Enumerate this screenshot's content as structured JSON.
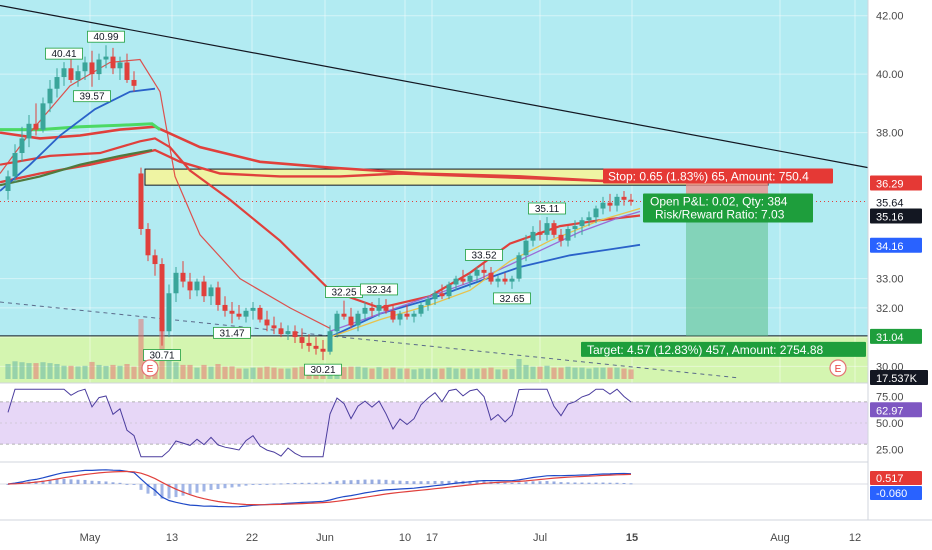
{
  "colors": {
    "bg": "#ffffff",
    "upper_zone": "#b2ebf2",
    "lower_zone": "#d4f5b0",
    "rsi_band": "#e1cdf5",
    "candle_up": "#3aa59a",
    "candle_down": "#e0403c",
    "ma_red": "#e0403c",
    "ma_green": "#4cd964",
    "ma_dark": "#4f7a3d",
    "ma_blue": "#2a62c9",
    "ma_purple": "#9b6bd6",
    "ma_yellow": "#e8c24b",
    "stop_zone": "#f28b86",
    "target_zone": "#5cc08a",
    "rect_fill": "#f5f59a",
    "label_red": "#e53935",
    "label_green": "#1e9e3c",
    "label_dark": "#131722",
    "rsi_line": "#4b3d9e",
    "macd_line": "#1e49c7",
    "signal_line": "#e0403c"
  },
  "price_axis": {
    "ticks": [
      "42.00",
      "40.00",
      "38.00",
      "33.00",
      "32.00",
      "31.00",
      "30.00"
    ],
    "tick_values": [
      42,
      40,
      38,
      33,
      32,
      31,
      30
    ],
    "badges": [
      {
        "text": "36.29",
        "value": 36.29,
        "kind": "red"
      },
      {
        "text": "35.64",
        "value": 35.64,
        "kind": "plain"
      },
      {
        "text": "35.16",
        "value": 35.16,
        "kind": "dark"
      },
      {
        "text": "34.16",
        "value": 34.16,
        "kind": "blue"
      },
      {
        "text": "31.04",
        "value": 31.04,
        "kind": "green"
      },
      {
        "text": "17.537K",
        "value": 0,
        "kind": "dark_volume"
      }
    ]
  },
  "rsi_axis": {
    "ticks": [
      "75.00",
      "50.00",
      "25.00"
    ],
    "tick_values": [
      75,
      50,
      25
    ],
    "badge": "62.97",
    "badge_value": 62.97
  },
  "macd_axis": {
    "badges": [
      "0.517",
      "-0.060"
    ]
  },
  "time_axis": {
    "labels": [
      "May",
      "13",
      "22",
      "Jun",
      "10",
      "17",
      "Jul",
      "15",
      "Aug",
      "12"
    ],
    "highlight": "15"
  },
  "price_labels": [
    {
      "text": "40.41",
      "value": 40.41,
      "idx": 8,
      "pos": "above"
    },
    {
      "text": "40.99",
      "value": 40.99,
      "idx": 14,
      "pos": "above"
    },
    {
      "text": "39.57",
      "value": 39.57,
      "idx": 12,
      "pos": "below"
    },
    {
      "text": "30.71",
      "value": 30.71,
      "idx": 22,
      "pos": "below"
    },
    {
      "text": "31.47",
      "value": 31.47,
      "idx": 32,
      "pos": "below"
    },
    {
      "text": "32.25",
      "value": 32.25,
      "idx": 48,
      "pos": "above"
    },
    {
      "text": "32.34",
      "value": 32.34,
      "idx": 53,
      "pos": "above"
    },
    {
      "text": "30.21",
      "value": 30.21,
      "idx": 45,
      "pos": "below"
    },
    {
      "text": "33.52",
      "value": 33.52,
      "idx": 68,
      "pos": "above"
    },
    {
      "text": "32.65",
      "value": 32.65,
      "idx": 72,
      "pos": "below"
    },
    {
      "text": "35.11",
      "value": 35.11,
      "idx": 77,
      "pos": "above"
    }
  ],
  "position_tool": {
    "stop_label": "Stop: 0.65 (1.83%) 65, Amount: 750.4",
    "pnl_label": "Open P&L: 0.02, Qty: 384",
    "rr_label": "Risk/Reward Ratio: 7.03",
    "target_label": "Target: 4.57 (12.83%) 457, Amount: 2754.88",
    "entry": 35.64,
    "stop": 36.29,
    "target": 31.04
  },
  "events": [
    "E",
    "E"
  ],
  "chart_data": {
    "type": "candlestick",
    "symbol_timeframe": "daily",
    "ohlc": [
      [
        36.0,
        36.7,
        35.7,
        36.5
      ],
      [
        36.5,
        37.6,
        36.3,
        37.3
      ],
      [
        37.3,
        38.2,
        37.0,
        37.8
      ],
      [
        37.8,
        38.6,
        37.5,
        38.3
      ],
      [
        38.3,
        39.0,
        37.9,
        38.1
      ],
      [
        38.1,
        39.2,
        38.0,
        39.0
      ],
      [
        39.0,
        39.8,
        38.7,
        39.5
      ],
      [
        39.5,
        40.2,
        39.2,
        39.9
      ],
      [
        39.9,
        40.41,
        39.6,
        40.2
      ],
      [
        40.2,
        40.5,
        39.7,
        39.8
      ],
      [
        39.8,
        40.3,
        39.57,
        40.1
      ],
      [
        40.1,
        40.6,
        39.8,
        40.4
      ],
      [
        40.4,
        40.8,
        39.57,
        40.0
      ],
      [
        40.0,
        40.7,
        39.8,
        40.5
      ],
      [
        40.5,
        40.99,
        40.2,
        40.6
      ],
      [
        40.6,
        40.9,
        40.0,
        40.2
      ],
      [
        40.2,
        40.6,
        39.8,
        40.4
      ],
      [
        40.4,
        40.7,
        39.7,
        39.8
      ],
      [
        39.8,
        40.1,
        39.4,
        39.6
      ],
      [
        36.6,
        36.8,
        34.5,
        34.7
      ],
      [
        34.7,
        34.9,
        33.6,
        33.8
      ],
      [
        33.8,
        34.0,
        33.1,
        33.5
      ],
      [
        33.5,
        33.7,
        30.71,
        31.2
      ],
      [
        31.2,
        32.8,
        31.0,
        32.5
      ],
      [
        32.5,
        33.4,
        32.2,
        33.2
      ],
      [
        33.2,
        33.6,
        32.7,
        32.9
      ],
      [
        32.9,
        33.2,
        32.3,
        32.6
      ],
      [
        32.6,
        33.0,
        32.4,
        32.9
      ],
      [
        32.9,
        33.1,
        32.2,
        32.4
      ],
      [
        32.4,
        32.8,
        32.1,
        32.7
      ],
      [
        32.7,
        32.9,
        31.9,
        32.1
      ],
      [
        32.1,
        32.4,
        31.7,
        31.9
      ],
      [
        31.9,
        32.2,
        31.47,
        31.8
      ],
      [
        31.8,
        32.1,
        31.6,
        31.7
      ],
      [
        31.7,
        32.0,
        31.5,
        31.9
      ],
      [
        31.9,
        32.2,
        31.6,
        32.0
      ],
      [
        32.0,
        32.1,
        31.5,
        31.6
      ],
      [
        31.6,
        31.9,
        31.2,
        31.4
      ],
      [
        31.4,
        31.7,
        31.1,
        31.3
      ],
      [
        31.3,
        31.5,
        31.0,
        31.1
      ],
      [
        31.1,
        31.4,
        30.9,
        31.2
      ],
      [
        31.2,
        31.4,
        30.8,
        31.0
      ],
      [
        31.0,
        31.3,
        30.6,
        30.8
      ],
      [
        30.8,
        31.1,
        30.5,
        30.7
      ],
      [
        30.7,
        31.0,
        30.4,
        30.6
      ],
      [
        30.6,
        30.9,
        30.21,
        30.5
      ],
      [
        30.5,
        31.4,
        30.4,
        31.2
      ],
      [
        31.2,
        31.9,
        31.0,
        31.8
      ],
      [
        31.8,
        32.25,
        31.6,
        31.7
      ],
      [
        31.7,
        32.0,
        31.3,
        31.4
      ],
      [
        31.4,
        31.9,
        31.2,
        31.8
      ],
      [
        31.8,
        32.2,
        31.6,
        32.0
      ],
      [
        32.0,
        32.2,
        31.7,
        31.9
      ],
      [
        31.9,
        32.34,
        31.7,
        32.1
      ],
      [
        32.1,
        32.3,
        31.8,
        31.9
      ],
      [
        31.9,
        32.1,
        31.5,
        31.6
      ],
      [
        31.6,
        31.9,
        31.4,
        31.8
      ],
      [
        31.8,
        32.1,
        31.6,
        31.7
      ],
      [
        31.7,
        31.9,
        31.5,
        31.8
      ],
      [
        31.8,
        32.2,
        31.7,
        32.1
      ],
      [
        32.1,
        32.4,
        31.9,
        32.3
      ],
      [
        32.3,
        32.6,
        32.1,
        32.5
      ],
      [
        32.5,
        32.8,
        32.3,
        32.4
      ],
      [
        32.4,
        32.9,
        32.3,
        32.8
      ],
      [
        32.8,
        33.1,
        32.6,
        33.0
      ],
      [
        33.0,
        33.3,
        32.8,
        32.9
      ],
      [
        32.9,
        33.2,
        32.7,
        33.1
      ],
      [
        33.1,
        33.4,
        32.9,
        33.3
      ],
      [
        33.3,
        33.52,
        33.0,
        33.2
      ],
      [
        33.2,
        33.4,
        32.8,
        32.9
      ],
      [
        32.9,
        33.1,
        32.7,
        33.0
      ],
      [
        33.0,
        33.2,
        32.8,
        32.9
      ],
      [
        32.9,
        33.1,
        32.65,
        33.0
      ],
      [
        33.0,
        33.9,
        32.9,
        33.8
      ],
      [
        33.8,
        34.5,
        33.6,
        34.3
      ],
      [
        34.3,
        34.8,
        34.1,
        34.6
      ],
      [
        34.6,
        35.0,
        34.3,
        34.5
      ],
      [
        34.5,
        35.11,
        34.3,
        34.9
      ],
      [
        34.9,
        35.0,
        34.4,
        34.5
      ],
      [
        34.5,
        34.7,
        34.1,
        34.3
      ],
      [
        34.3,
        34.8,
        34.1,
        34.7
      ],
      [
        34.7,
        35.0,
        34.4,
        34.8
      ],
      [
        34.8,
        35.1,
        34.5,
        35.0
      ],
      [
        35.0,
        35.3,
        34.8,
        35.1
      ],
      [
        35.1,
        35.5,
        34.9,
        35.4
      ],
      [
        35.4,
        35.8,
        35.2,
        35.6
      ],
      [
        35.6,
        35.9,
        35.3,
        35.5
      ],
      [
        35.5,
        35.9,
        35.3,
        35.8
      ],
      [
        35.8,
        36.0,
        35.5,
        35.7
      ],
      [
        35.7,
        35.9,
        35.5,
        35.64
      ]
    ],
    "rsi_range": [
      0,
      100
    ],
    "y_range": [
      29.6,
      42.4
    ],
    "x_labels": [
      "May",
      "13",
      "22",
      "Jun",
      "10",
      "17",
      "Jul",
      "15",
      "Aug",
      "12"
    ]
  }
}
